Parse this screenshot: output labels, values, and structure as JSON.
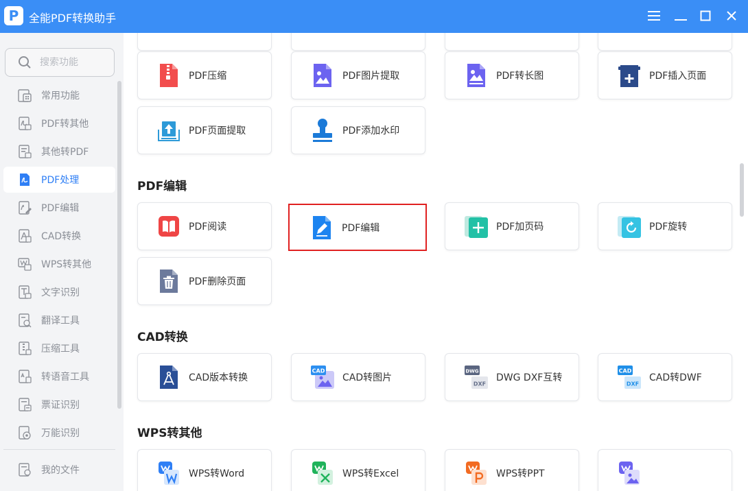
{
  "app": {
    "logo_letter": "P",
    "title": "全能PDF转换助手"
  },
  "window_controls": [
    "menu-icon",
    "minimize-icon",
    "maximize-icon",
    "close-icon"
  ],
  "search": {
    "placeholder": "搜索功能"
  },
  "sidebar": {
    "items": [
      {
        "label": "常用功能",
        "icon": "common-tools-icon",
        "active": false
      },
      {
        "label": "PDF转其他",
        "icon": "pdf-convert-icon",
        "active": false
      },
      {
        "label": "其他转PDF",
        "icon": "to-pdf-icon",
        "active": false
      },
      {
        "label": "PDF处理",
        "icon": "pdf-process-icon",
        "active": true
      },
      {
        "label": "PDF编辑",
        "icon": "pdf-edit-icon",
        "active": false
      },
      {
        "label": "CAD转换",
        "icon": "cad-icon",
        "active": false
      },
      {
        "label": "WPS转其他",
        "icon": "wps-icon",
        "active": false
      },
      {
        "label": "文字识别",
        "icon": "ocr-icon",
        "active": false
      },
      {
        "label": "翻译工具",
        "icon": "translate-icon",
        "active": false
      },
      {
        "label": "压缩工具",
        "icon": "compress-icon",
        "active": false
      },
      {
        "label": "转语音工具",
        "icon": "speech-icon",
        "active": false
      },
      {
        "label": "票证识别",
        "icon": "ticket-icon",
        "active": false
      },
      {
        "label": "万能识别",
        "icon": "universal-recognition-icon",
        "active": false
      }
    ],
    "footer_item": {
      "label": "我的文件",
      "icon": "my-files-icon"
    }
  },
  "sections": {
    "pdf_process": {
      "cards": [
        {
          "label": "PDF压缩",
          "icon": "zip-file-icon"
        },
        {
          "label": "PDF图片提取",
          "icon": "image-file-icon"
        },
        {
          "label": "PDF转长图",
          "icon": "long-image-icon"
        },
        {
          "label": "PDF插入页面",
          "icon": "insert-page-icon"
        },
        {
          "label": "PDF页面提取",
          "icon": "page-extract-icon"
        },
        {
          "label": "PDF添加水印",
          "icon": "watermark-stamp-icon"
        }
      ]
    },
    "pdf_edit": {
      "title": "PDF编辑",
      "cards": [
        {
          "label": "PDF阅读",
          "icon": "book-icon"
        },
        {
          "label": "PDF编辑",
          "icon": "edit-file-icon",
          "highlighted": true
        },
        {
          "label": "PDF加页码",
          "icon": "add-page-number-icon"
        },
        {
          "label": "PDF旋转",
          "icon": "rotate-icon"
        },
        {
          "label": "PDF删除页面",
          "icon": "trash-file-icon"
        }
      ]
    },
    "cad": {
      "title": "CAD转换",
      "cards": [
        {
          "label": "CAD版本转换",
          "icon": "cad-version-icon"
        },
        {
          "label": "CAD转图片",
          "icon": "cad-to-image-icon",
          "badge": "CAD"
        },
        {
          "label": "DWG DXF互转",
          "icon": "dwg-dxf-icon",
          "badges": [
            "DWG",
            "DXF"
          ]
        },
        {
          "label": "CAD转DWF",
          "icon": "cad-to-dwf-icon",
          "badges": [
            "CAD",
            "DXF"
          ]
        }
      ]
    },
    "wps": {
      "title": "WPS转其他",
      "cards": [
        {
          "label": "WPS转Word",
          "icon": "wps-word-icon"
        },
        {
          "label": "WPS转Excel",
          "icon": "wps-excel-icon"
        },
        {
          "label": "WPS转PPT",
          "icon": "wps-ppt-icon"
        },
        {
          "label": "",
          "icon": "wps-image-icon"
        }
      ]
    }
  },
  "colors": {
    "titlebar": "#3a8ef6",
    "active_nav": "#2f7ff5",
    "highlight_border": "#e02020"
  }
}
